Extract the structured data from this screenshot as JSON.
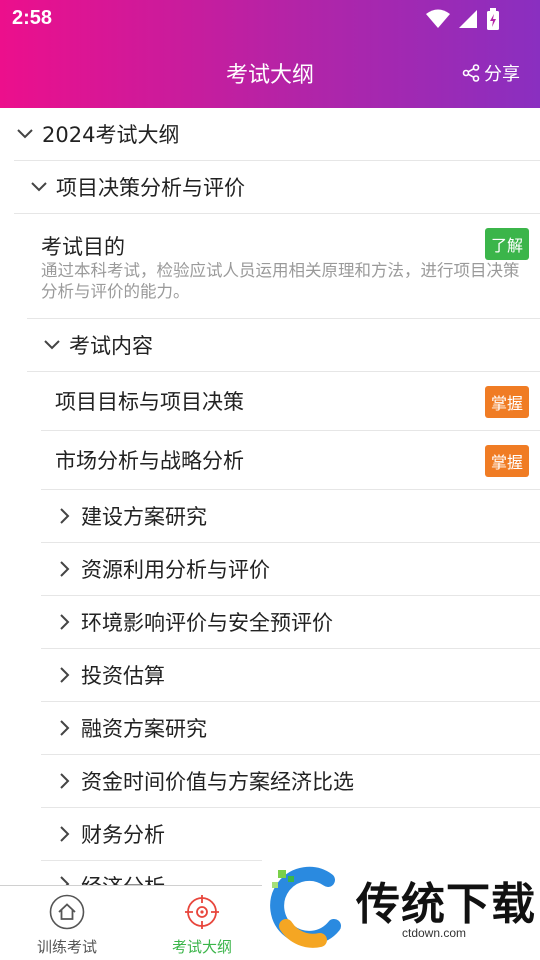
{
  "status_bar": {
    "time": "2:58"
  },
  "header": {
    "title": "考试大纲",
    "share_label": "分享"
  },
  "outline": {
    "root": "2024考试大纲",
    "section": "项目决策分析与评价",
    "objective": {
      "title": "考试目的",
      "badge": "了解",
      "description": "通过本科考试，检验应试人员运用相关原理和方法，进行项目决策分析与评价的能力。"
    },
    "content_header": "考试内容",
    "mastery_items": [
      {
        "label": "项目目标与项目决策",
        "badge": "掌握"
      },
      {
        "label": "市场分析与战略分析",
        "badge": "掌握"
      }
    ],
    "collapsed_items": [
      "建设方案研究",
      "资源利用分析与评价",
      "环境影响评价与安全预评价",
      "投资估算",
      "融资方案研究",
      "资金时间价值与方案经济比选",
      "财务分析",
      "经济分析"
    ]
  },
  "bottom_nav": {
    "items": [
      {
        "label": "训练考试",
        "color": "#555555"
      },
      {
        "label": "考试大纲",
        "color": "#3bb54a"
      }
    ]
  },
  "colors": {
    "header_start": "#ec0f8c",
    "header_end": "#8a2fc0",
    "badge_understand": "#3bb54a",
    "badge_master": "#f07c24",
    "nav_active": "#3bb54a",
    "nav_active_icon": "#e8463c"
  },
  "watermark": {
    "text": "传统下载",
    "url": "ctdown.com"
  }
}
